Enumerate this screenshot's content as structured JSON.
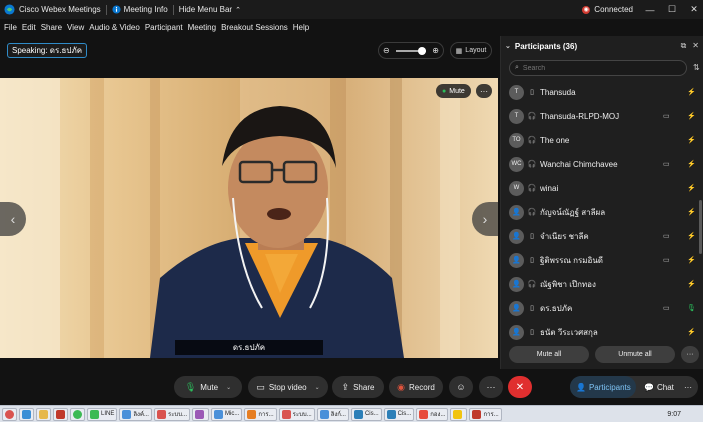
{
  "titlebar": {
    "app_title": "Cisco Webex Meetings",
    "meeting_info": "Meeting Info",
    "hide_menu_bar": "Hide Menu Bar",
    "connected": "Connected"
  },
  "menu": [
    "File",
    "Edit",
    "Share",
    "View",
    "Audio & Video",
    "Participant",
    "Meeting",
    "Breakout Sessions",
    "Help"
  ],
  "speaking_label": "Speaking: ดร.ธปภัค",
  "layout_label": "Layout",
  "video": {
    "name_tag": "ดร.ธปภัค",
    "mute_label": "Mute"
  },
  "panel": {
    "title": "Participants (36)",
    "search_placeholder": "Search",
    "participants": [
      {
        "initials": "T",
        "name": "Thansuda",
        "device": "phone",
        "camera": false,
        "mic": "muted"
      },
      {
        "initials": "T",
        "name": "Thansuda-RLPD-MOJ",
        "device": "headset",
        "camera": true,
        "mic": "muted"
      },
      {
        "initials": "TO",
        "name": "The one",
        "device": "headset",
        "camera": false,
        "mic": "muted"
      },
      {
        "initials": "WC",
        "name": "Wanchai Chimchavee",
        "device": "headset",
        "camera": true,
        "mic": "muted"
      },
      {
        "initials": "W",
        "name": "winai",
        "device": "headset",
        "camera": false,
        "mic": "muted"
      },
      {
        "initials": "",
        "name": "กัญจน์ณัฏฐ์ สาลีผล",
        "device": "headset",
        "camera": false,
        "mic": "muted"
      },
      {
        "initials": "",
        "name": "จำเนียร ชาลีค",
        "device": "phone",
        "camera": true,
        "mic": "muted"
      },
      {
        "initials": "",
        "name": "ฐิติพรรณ กรมอินดี",
        "device": "phone",
        "camera": true,
        "mic": "muted"
      },
      {
        "initials": "",
        "name": "ณัฐพิชา เป๊กทอง",
        "device": "headset",
        "camera": false,
        "mic": "muted"
      },
      {
        "initials": "",
        "name": "ดร.ธปภัค",
        "device": "phone",
        "camera": true,
        "mic": "on"
      },
      {
        "initials": "",
        "name": "ธนัต วีระเวศสกุล",
        "device": "phone",
        "camera": false,
        "mic": "muted"
      }
    ],
    "mute_all": "Mute all",
    "unmute_all": "Unmute all"
  },
  "controls": {
    "mute": "Mute",
    "stop_video": "Stop video",
    "share": "Share",
    "record": "Record",
    "participants_tab": "Participants",
    "chat_tab": "Chat"
  },
  "taskbar": {
    "tasks": [
      "LINE",
      "ลิงค์...",
      "ระบบ...",
      "",
      "Mic...",
      "การ...",
      "ระบบ...",
      "ลิงก์...",
      "Cis...",
      "Cis...",
      "กอง...",
      "",
      "การ..."
    ],
    "clock": "9:07"
  },
  "colors": {
    "accent_blue": "#2f8bc8",
    "muted_red": "#e0533c",
    "mic_on_green": "#2bbd5b",
    "leave_red": "#e02f2f"
  }
}
